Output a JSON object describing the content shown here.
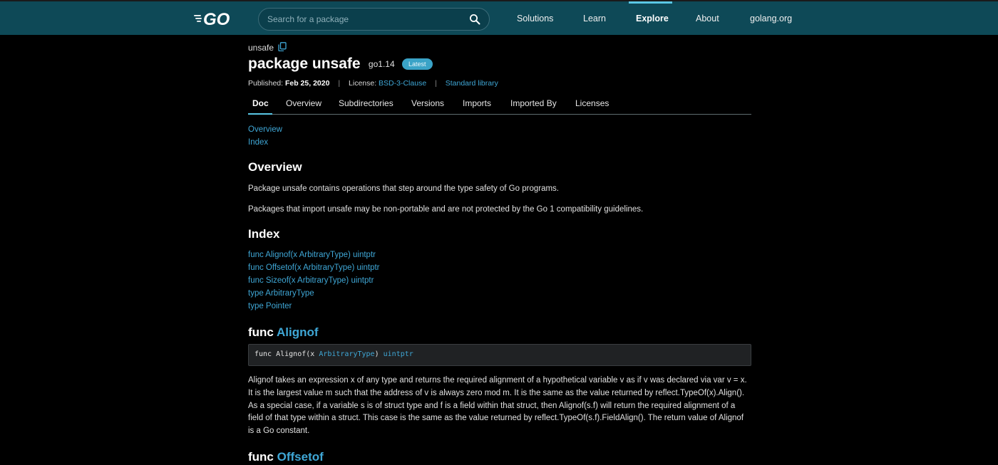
{
  "header": {
    "logo": "GO",
    "search": {
      "placeholder": "Search for a package"
    },
    "nav": [
      {
        "label": "Solutions"
      },
      {
        "label": "Learn"
      },
      {
        "label": "Explore",
        "active": true
      },
      {
        "label": "About"
      },
      {
        "label": "golang.org"
      }
    ]
  },
  "package": {
    "breadcrumb": "unsafe",
    "title": "package unsafe",
    "version": "go1.14",
    "badge": "Latest",
    "published_label": "Published:",
    "published_date": "Feb 25, 2020",
    "license_label": "License:",
    "license": "BSD-3-Clause",
    "stdlib": "Standard library"
  },
  "tabs": [
    {
      "label": "Doc",
      "active": true
    },
    {
      "label": "Overview"
    },
    {
      "label": "Subdirectories"
    },
    {
      "label": "Versions"
    },
    {
      "label": "Imports"
    },
    {
      "label": "Imported By"
    },
    {
      "label": "Licenses"
    }
  ],
  "toc": [
    "Overview",
    "Index"
  ],
  "overview": {
    "heading": "Overview",
    "paragraphs": [
      "Package unsafe contains operations that step around the type safety of Go programs.",
      "Packages that import unsafe may be non-portable and are not protected by the Go 1 compatibility guidelines."
    ]
  },
  "index": {
    "heading": "Index",
    "items": [
      "func Alignof(x ArbitraryType) uintptr",
      "func Offsetof(x ArbitraryType) uintptr",
      "func Sizeof(x ArbitraryType) uintptr",
      "type ArbitraryType",
      "type Pointer"
    ]
  },
  "alignof": {
    "keyword": "func",
    "name": "Alignof",
    "signature_prefix": "func Alignof(x ",
    "signature_type": "ArbitraryType",
    "signature_mid": ") ",
    "signature_return": "uintptr",
    "description": "Alignof takes an expression x of any type and returns the required alignment of a hypothetical variable v as if v was declared via var v = x. It is the largest value m such that the address of v is always zero mod m. It is the same as the value returned by reflect.TypeOf(x).Align(). As a special case, if a variable s is of struct type and f is a field within that struct, then Alignof(s.f) will return the required alignment of a field of that type within a struct. This case is the same as the value returned by reflect.TypeOf(s.f).FieldAlign(). The return value of Alignof is a Go constant."
  },
  "offsetof": {
    "keyword": "func",
    "name": "Offsetof"
  }
}
